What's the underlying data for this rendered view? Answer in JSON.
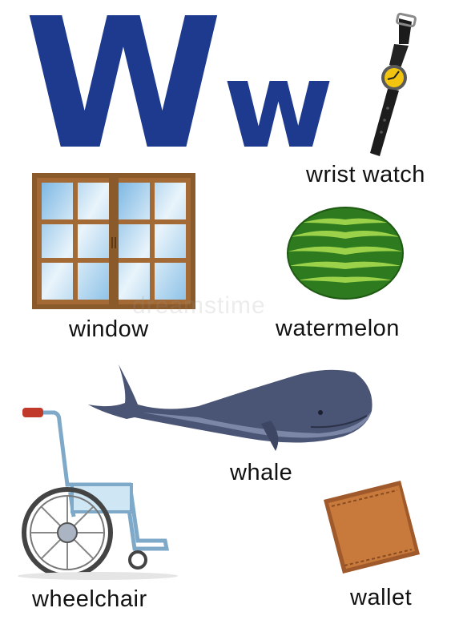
{
  "title": {
    "upper": "W",
    "lower": "w"
  },
  "items": [
    {
      "label": "wrist watch",
      "icon": "wrist-watch-icon"
    },
    {
      "label": "window",
      "icon": "window-icon"
    },
    {
      "label": "watermelon",
      "icon": "watermelon-icon"
    },
    {
      "label": "whale",
      "icon": "whale-icon"
    },
    {
      "label": "wheelchair",
      "icon": "wheelchair-icon"
    },
    {
      "label": "wallet",
      "icon": "wallet-icon"
    }
  ],
  "watermark": "dreamstime",
  "colors": {
    "letter": "#1d3a8f",
    "text": "#111111"
  }
}
